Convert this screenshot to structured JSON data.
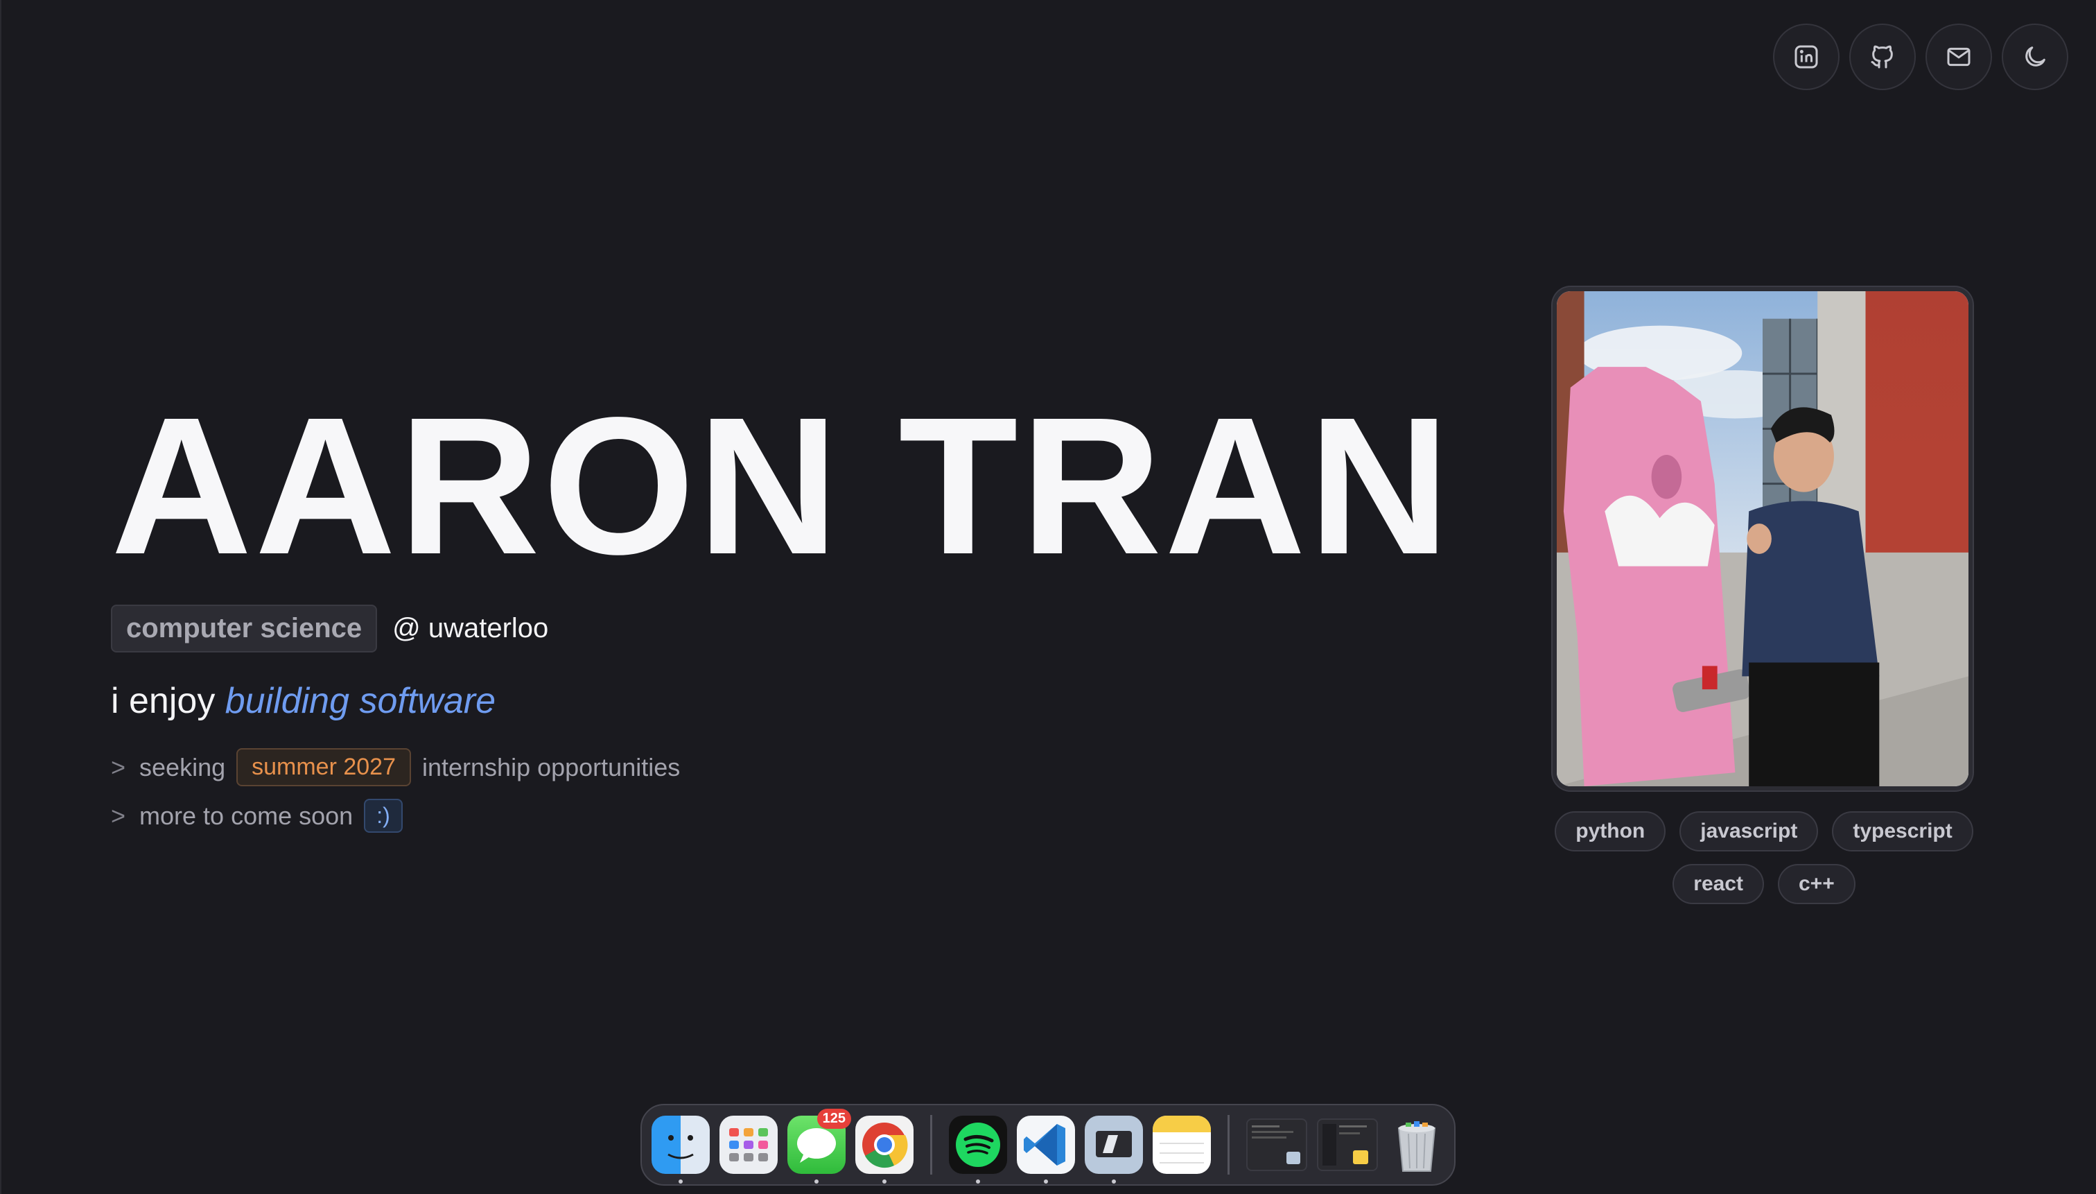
{
  "profile": {
    "name": "AARON TRAN",
    "field": "computer science",
    "school": "@ uwaterloo",
    "enjoy_prefix": "i enjoy",
    "enjoy_highlight": "building software"
  },
  "bullets": {
    "seeking_prefix": "seeking",
    "seeking_pill": "summer 2027",
    "seeking_suffix": "internship opportunities",
    "more_text": "more to come soon",
    "more_pill": ":)",
    "marker": ">"
  },
  "skills": [
    "python",
    "javascript",
    "typescript",
    "react",
    "c++"
  ],
  "top_icons": [
    "linkedin-icon",
    "github-icon",
    "mail-icon",
    "moon-icon"
  ],
  "dock": {
    "messages_badge": "125",
    "apps": [
      "finder",
      "launchpad",
      "messages",
      "chrome",
      "spotify",
      "vscode",
      "parallels",
      "notes",
      "window-thumbnail",
      "window-thumbnail",
      "trash"
    ]
  },
  "colors": {
    "background": "#1a1a1f",
    "accent_blue": "#6f9cf0",
    "accent_orange": "#e8914c"
  }
}
